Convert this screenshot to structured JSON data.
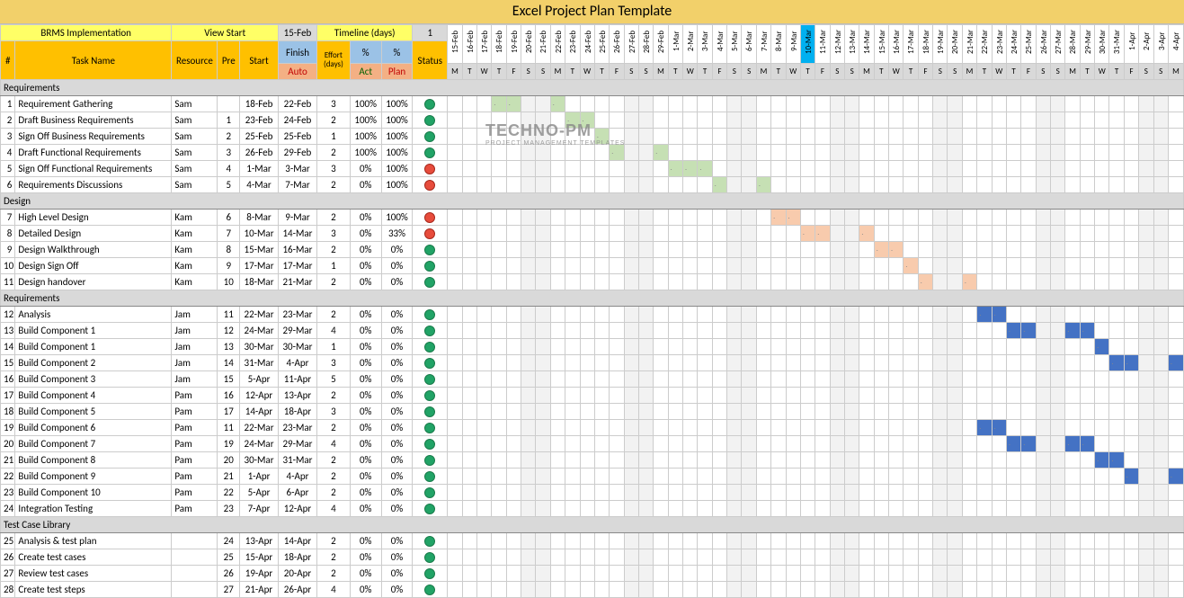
{
  "title": "Excel Project Plan Template",
  "project_label": "BRMS Implementation",
  "view_start_label": "View Start",
  "view_start_date": "15-Feb",
  "timeline_label": "Timeline (days)",
  "timeline_step": "1",
  "headers": {
    "num": "#",
    "task": "Task Name",
    "resource": "Resource",
    "pre": "Pre",
    "start": "Start",
    "finish": "Finish",
    "effort": "Effort (days)",
    "pct_act": "% Act",
    "pct_plan": "% Plan",
    "status": "Status",
    "auto": "Auto"
  },
  "watermark": {
    "brand": "TECHNO",
    "brand2": "-PM",
    "sub": "PROJECT MANAGEMENT TEMPLATES"
  },
  "dates": [
    "15-Feb",
    "16-Feb",
    "17-Feb",
    "18-Feb",
    "19-Feb",
    "20-Feb",
    "21-Feb",
    "22-Feb",
    "23-Feb",
    "24-Feb",
    "25-Feb",
    "26-Feb",
    "27-Feb",
    "28-Feb",
    "29-Feb",
    "1-Mar",
    "2-Mar",
    "3-Mar",
    "4-Mar",
    "5-Mar",
    "6-Mar",
    "7-Mar",
    "8-Mar",
    "9-Mar",
    "10-Mar",
    "11-Mar",
    "12-Mar",
    "13-Mar",
    "14-Mar",
    "15-Mar",
    "16-Mar",
    "17-Mar",
    "18-Mar",
    "19-Mar",
    "20-Mar",
    "21-Mar",
    "22-Mar",
    "23-Mar",
    "24-Mar",
    "25-Mar",
    "26-Mar",
    "27-Mar",
    "28-Mar",
    "29-Mar",
    "30-Mar",
    "31-Mar",
    "1-Apr",
    "2-Apr",
    "3-Apr",
    "4-Apr"
  ],
  "dow": [
    "M",
    "T",
    "W",
    "T",
    "F",
    "S",
    "S",
    "M",
    "T",
    "W",
    "T",
    "F",
    "S",
    "S",
    "M",
    "T",
    "W",
    "T",
    "F",
    "S",
    "S",
    "M",
    "T",
    "W",
    "T",
    "F",
    "S",
    "S",
    "M",
    "T",
    "W",
    "T",
    "F",
    "S",
    "S",
    "M",
    "T",
    "W",
    "T",
    "F",
    "S",
    "S",
    "M",
    "T",
    "W",
    "T",
    "F",
    "S",
    "S",
    "M"
  ],
  "today_idx": 24,
  "sections": [
    {
      "name": "Requirements",
      "tasks": [
        {
          "n": 1,
          "name": "Requirement Gathering",
          "res": "Sam",
          "pre": "",
          "start": "18-Feb",
          "finish": "22-Feb",
          "eff": 3,
          "act": "100%",
          "plan": "100%",
          "status": "g",
          "bar_s": 3,
          "bar_e": 7,
          "bar_c": "done"
        },
        {
          "n": 2,
          "name": "Draft Business Requirements",
          "res": "Sam",
          "pre": 1,
          "start": "23-Feb",
          "finish": "24-Feb",
          "eff": 2,
          "act": "100%",
          "plan": "100%",
          "status": "g",
          "bar_s": 8,
          "bar_e": 9,
          "bar_c": "done"
        },
        {
          "n": 3,
          "name": "Sign Off Business Requirements",
          "res": "Sam",
          "pre": 2,
          "start": "25-Feb",
          "finish": "25-Feb",
          "eff": 1,
          "act": "100%",
          "plan": "100%",
          "status": "g",
          "bar_s": 10,
          "bar_e": 10,
          "bar_c": "done"
        },
        {
          "n": 4,
          "name": "Draft Functional Requirements",
          "res": "Sam",
          "pre": 3,
          "start": "26-Feb",
          "finish": "29-Feb",
          "eff": 2,
          "act": "100%",
          "plan": "100%",
          "status": "g",
          "bar_s": 11,
          "bar_e": 14,
          "bar_c": "done"
        },
        {
          "n": 5,
          "name": "Sign Off Functional Requirements",
          "res": "Sam",
          "pre": 4,
          "start": "1-Mar",
          "finish": "3-Mar",
          "eff": 3,
          "act": "0%",
          "plan": "100%",
          "status": "r",
          "bar_s": 15,
          "bar_e": 17,
          "bar_c": "done"
        },
        {
          "n": 6,
          "name": "Requirements Discussions",
          "res": "Sam",
          "pre": 5,
          "start": "4-Mar",
          "finish": "7-Mar",
          "eff": 2,
          "act": "0%",
          "plan": "100%",
          "status": "r",
          "bar_s": 18,
          "bar_e": 21,
          "bar_c": "done"
        }
      ]
    },
    {
      "name": "Design",
      "tasks": [
        {
          "n": 7,
          "name": "High Level Design",
          "res": "Kam",
          "pre": 6,
          "start": "8-Mar",
          "finish": "9-Mar",
          "eff": 2,
          "act": "0%",
          "plan": "100%",
          "status": "r",
          "bar_s": 22,
          "bar_e": 23,
          "bar_c": "ongoing"
        },
        {
          "n": 8,
          "name": "Detailed Design",
          "res": "Kam",
          "pre": 7,
          "start": "10-Mar",
          "finish": "14-Mar",
          "eff": 3,
          "act": "0%",
          "plan": "33%",
          "status": "r",
          "bar_s": 24,
          "bar_e": 28,
          "bar_c": "ongoing"
        },
        {
          "n": 9,
          "name": "Design Walkthrough",
          "res": "Kam",
          "pre": 8,
          "start": "15-Mar",
          "finish": "16-Mar",
          "eff": 2,
          "act": "0%",
          "plan": "0%",
          "status": "g",
          "bar_s": 29,
          "bar_e": 30,
          "bar_c": "ongoing"
        },
        {
          "n": 10,
          "name": "Design Sign Off",
          "res": "Kam",
          "pre": 9,
          "start": "17-Mar",
          "finish": "17-Mar",
          "eff": 1,
          "act": "0%",
          "plan": "0%",
          "status": "g",
          "bar_s": 31,
          "bar_e": 31,
          "bar_c": "ongoing"
        },
        {
          "n": 11,
          "name": "Design handover",
          "res": "Kam",
          "pre": 10,
          "start": "18-Mar",
          "finish": "21-Mar",
          "eff": 2,
          "act": "0%",
          "plan": "0%",
          "status": "g",
          "bar_s": 32,
          "bar_e": 35,
          "bar_c": "ongoing"
        }
      ]
    },
    {
      "name": "Requirements",
      "tasks": [
        {
          "n": 12,
          "name": "Analysis",
          "res": "Jam",
          "pre": 11,
          "start": "22-Mar",
          "finish": "23-Mar",
          "eff": 2,
          "act": "0%",
          "plan": "0%",
          "status": "g",
          "bar_s": 36,
          "bar_e": 37,
          "bar_c": "future"
        },
        {
          "n": 13,
          "name": "Build Component 1",
          "res": "Jam",
          "pre": 12,
          "start": "24-Mar",
          "finish": "29-Mar",
          "eff": 4,
          "act": "0%",
          "plan": "0%",
          "status": "g",
          "bar_s": 38,
          "bar_e": 43,
          "bar_c": "future"
        },
        {
          "n": 14,
          "name": "Build Component 1",
          "res": "Jam",
          "pre": 13,
          "start": "30-Mar",
          "finish": "30-Mar",
          "eff": 1,
          "act": "0%",
          "plan": "0%",
          "status": "g",
          "bar_s": 44,
          "bar_e": 44,
          "bar_c": "future"
        },
        {
          "n": 15,
          "name": "Build Component 2",
          "res": "Jam",
          "pre": 14,
          "start": "31-Mar",
          "finish": "4-Apr",
          "eff": 3,
          "act": "0%",
          "plan": "0%",
          "status": "g",
          "bar_s": 45,
          "bar_e": 49,
          "bar_c": "future"
        },
        {
          "n": 16,
          "name": "Build Component 3",
          "res": "Jam",
          "pre": 15,
          "start": "5-Apr",
          "finish": "11-Apr",
          "eff": 5,
          "act": "0%",
          "plan": "0%",
          "status": "g",
          "bar_s": 50,
          "bar_e": 50,
          "bar_c": "future"
        },
        {
          "n": 17,
          "name": "Build Component 4",
          "res": "Pam",
          "pre": 16,
          "start": "12-Apr",
          "finish": "13-Apr",
          "eff": 2,
          "act": "0%",
          "plan": "0%",
          "status": "g"
        },
        {
          "n": 18,
          "name": "Build Component 5",
          "res": "Pam",
          "pre": 17,
          "start": "14-Apr",
          "finish": "18-Apr",
          "eff": 3,
          "act": "0%",
          "plan": "0%",
          "status": "g"
        },
        {
          "n": 19,
          "name": "Build Component 6",
          "res": "Pam",
          "pre": 11,
          "start": "22-Mar",
          "finish": "23-Mar",
          "eff": 2,
          "act": "0%",
          "plan": "0%",
          "status": "g",
          "bar_s": 36,
          "bar_e": 37,
          "bar_c": "future"
        },
        {
          "n": 20,
          "name": "Build Component 7",
          "res": "Pam",
          "pre": 19,
          "start": "24-Mar",
          "finish": "29-Mar",
          "eff": 4,
          "act": "0%",
          "plan": "0%",
          "status": "g",
          "bar_s": 38,
          "bar_e": 43,
          "bar_c": "future"
        },
        {
          "n": 21,
          "name": "Build Component 8",
          "res": "Pam",
          "pre": 20,
          "start": "30-Mar",
          "finish": "31-Mar",
          "eff": 2,
          "act": "0%",
          "plan": "0%",
          "status": "g",
          "bar_s": 44,
          "bar_e": 45,
          "bar_c": "future"
        },
        {
          "n": 22,
          "name": "Build Component 9",
          "res": "Pam",
          "pre": 21,
          "start": "1-Apr",
          "finish": "4-Apr",
          "eff": 2,
          "act": "0%",
          "plan": "0%",
          "status": "g",
          "bar_s": 46,
          "bar_e": 49,
          "bar_c": "future"
        },
        {
          "n": 23,
          "name": "Build Component 10",
          "res": "Pam",
          "pre": 22,
          "start": "5-Apr",
          "finish": "6-Apr",
          "eff": 2,
          "act": "0%",
          "plan": "0%",
          "status": "g",
          "bar_s": 50,
          "bar_e": 50,
          "bar_c": "future"
        },
        {
          "n": 24,
          "name": "Integration Testing",
          "res": "Pam",
          "pre": 23,
          "start": "7-Apr",
          "finish": "12-Apr",
          "eff": 4,
          "act": "0%",
          "plan": "0%",
          "status": "g"
        }
      ]
    },
    {
      "name": "Test Case Library",
      "tasks": [
        {
          "n": 25,
          "name": "Analysis & test plan",
          "res": "",
          "pre": 24,
          "start": "13-Apr",
          "finish": "14-Apr",
          "eff": 2,
          "act": "0%",
          "plan": "0%",
          "status": "g"
        },
        {
          "n": 26,
          "name": "Create test cases",
          "res": "",
          "pre": 25,
          "start": "15-Apr",
          "finish": "18-Apr",
          "eff": 2,
          "act": "0%",
          "plan": "0%",
          "status": "g"
        },
        {
          "n": 27,
          "name": "Review test cases",
          "res": "",
          "pre": 26,
          "start": "19-Apr",
          "finish": "20-Apr",
          "eff": 2,
          "act": "0%",
          "plan": "0%",
          "status": "g"
        },
        {
          "n": 28,
          "name": "Create test steps",
          "res": "",
          "pre": 27,
          "start": "21-Apr",
          "finish": "26-Apr",
          "eff": 4,
          "act": "0%",
          "plan": "0%",
          "status": "g"
        }
      ]
    }
  ]
}
